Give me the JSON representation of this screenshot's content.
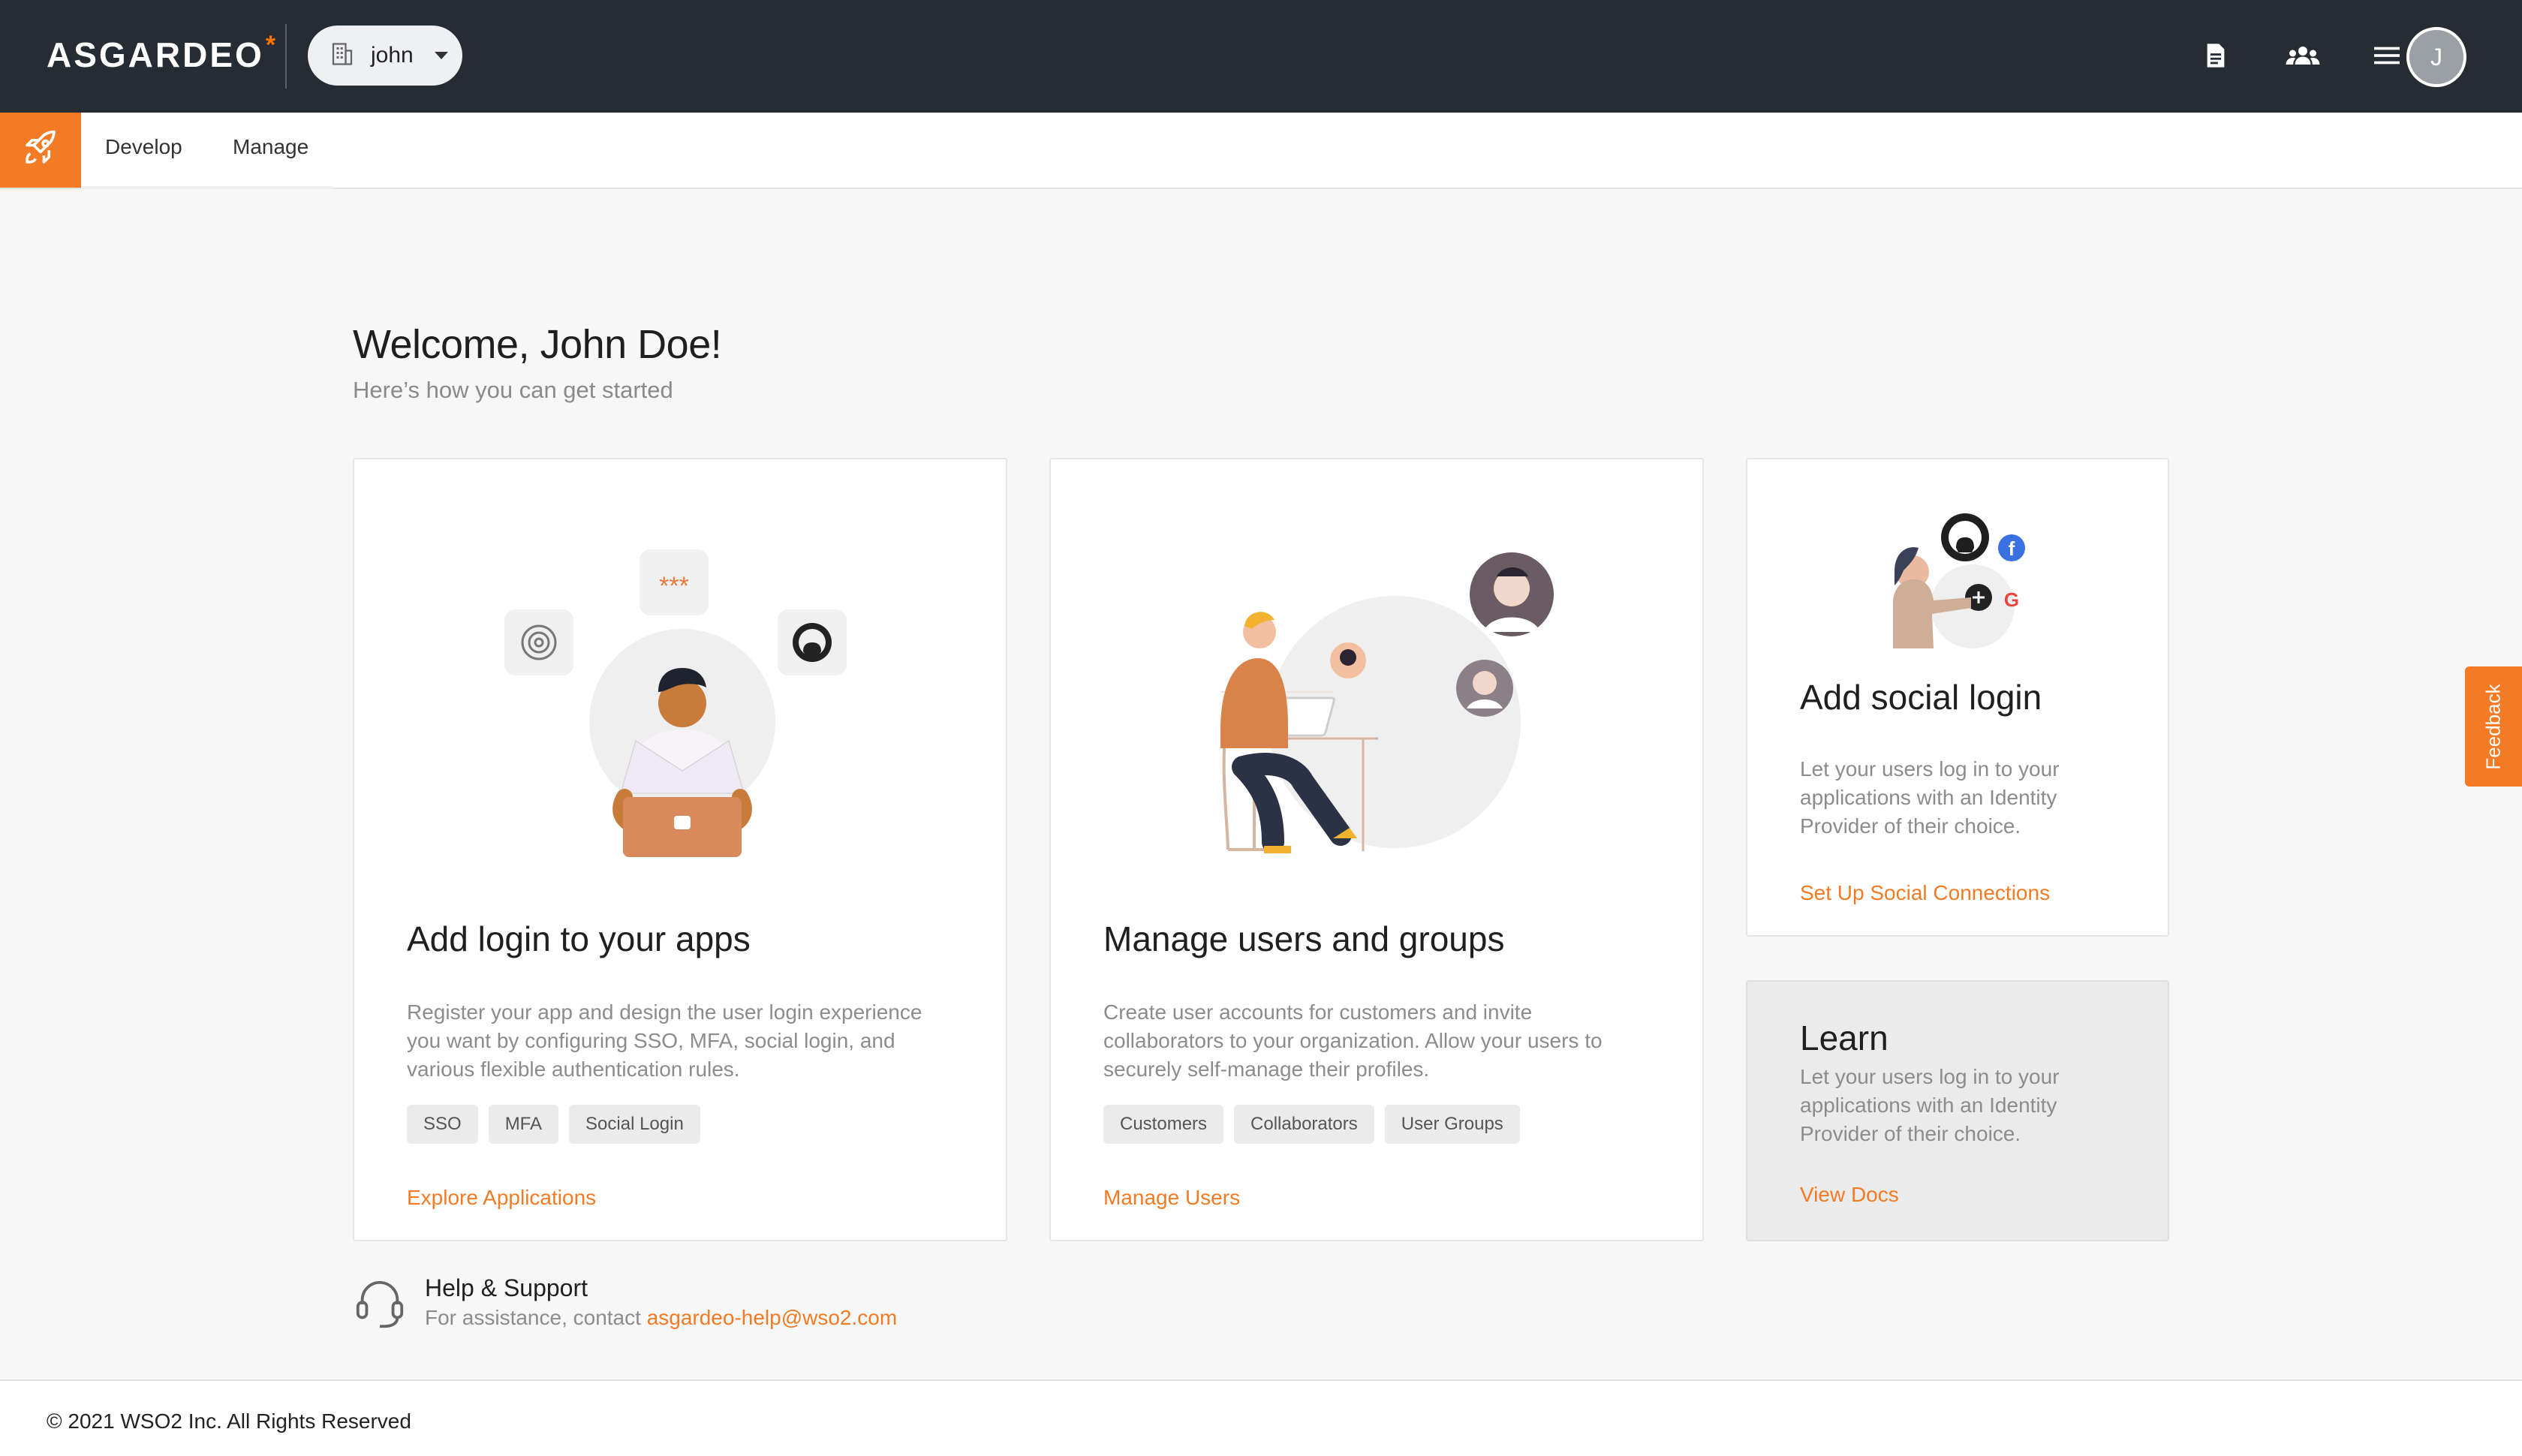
{
  "header": {
    "logo_text": "ASGARDEO",
    "logo_mark": "*",
    "org_name": "john",
    "avatar_initial": "J",
    "icons": [
      "document-icon",
      "users-icon",
      "menu-icon"
    ]
  },
  "subnav": {
    "tabs": [
      {
        "label": "Develop"
      },
      {
        "label": "Manage"
      }
    ]
  },
  "welcome": {
    "title": "Welcome, John Doe!",
    "subtitle": "Here’s how you can get started"
  },
  "cards": {
    "login": {
      "title": "Add login to your apps",
      "description": "Register your app and design the user login experience you want by configuring SSO, MFA, social login, and various flexible authentication rules.",
      "tags": [
        "SSO",
        "MFA",
        "Social Login"
      ],
      "link": "Explore Applications"
    },
    "users": {
      "title": "Manage users and groups",
      "description": "Create user accounts for customers and invite collaborators to your organization. Allow your users to securely self-manage their profiles.",
      "tags": [
        "Customers",
        "Collaborators",
        "User Groups"
      ],
      "link": "Manage Users"
    },
    "social": {
      "title": "Add social login",
      "description": "Let your users log in to your applications with an Identity Provider of their choice.",
      "link": "Set Up Social Connections"
    },
    "learn": {
      "title": "Learn",
      "description": "Let your users log in to your applications with an Identity Provider of their choice.",
      "link": "View Docs"
    }
  },
  "help": {
    "title": "Help & Support",
    "text": "For assistance, contact ",
    "email": "asgardeo-help@wso2.com"
  },
  "footer": {
    "copyright": "© 2021 WSO2 Inc. All Rights Reserved"
  },
  "feedback": {
    "label": "Feedback"
  },
  "colors": {
    "accent": "#f47b25",
    "header_bg": "#262c33",
    "page_bg": "#f7f7f7"
  }
}
